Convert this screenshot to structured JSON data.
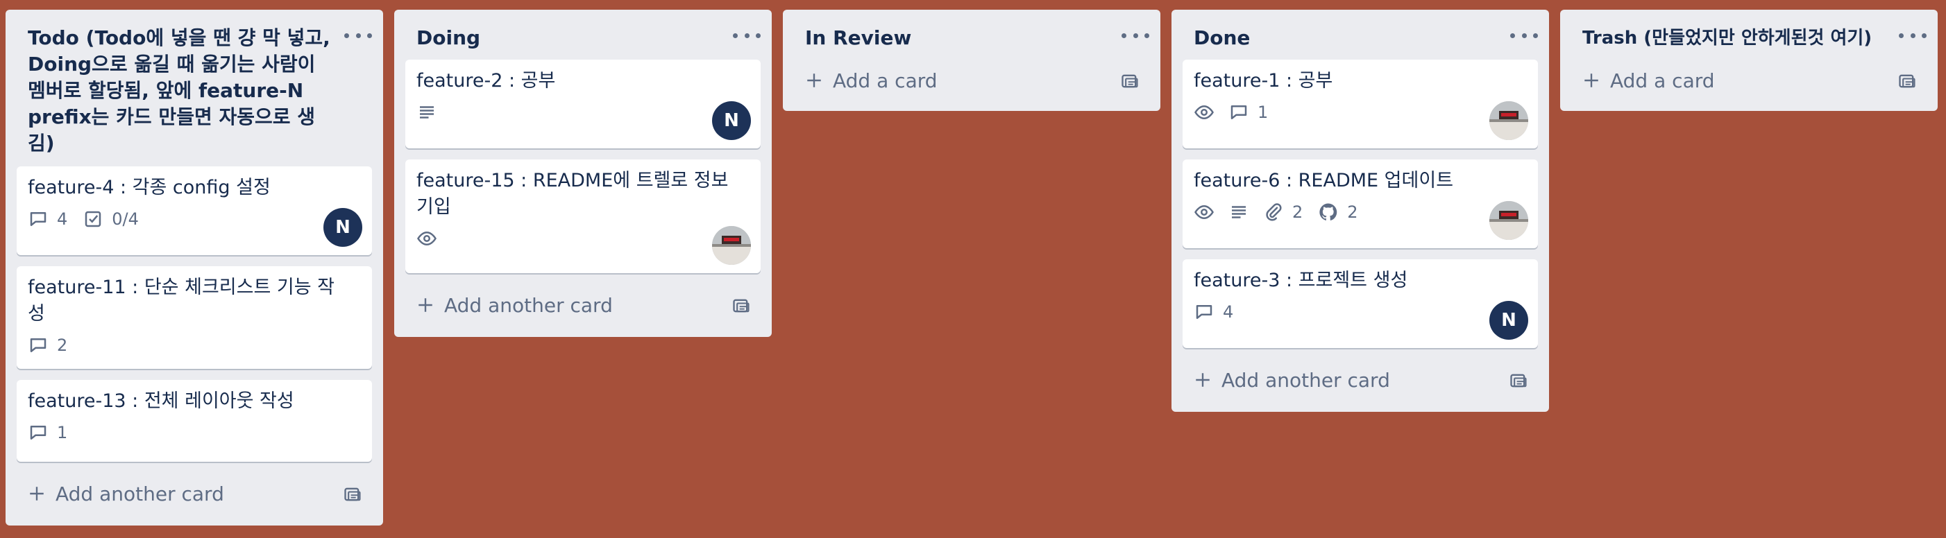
{
  "colors": {
    "board_bg": "#a6503a",
    "list_bg": "#ebecf0",
    "avatar_n": "#1d3258"
  },
  "lists": [
    {
      "title": "Todo (Todo에 넣을 땐 걍 막 넣고, Doing으로 옮길 때 옮기는 사람이 멤버로 할당됨, 앞에 feature-N prefix는 카드 만들면 자동으로 생김)",
      "add_label": "Add another card",
      "cards": [
        {
          "title": "feature-4 : 각종 config 설정",
          "comments": "4",
          "checklist": "0/4",
          "avatar": "N"
        },
        {
          "title": "feature-11 : 단순 체크리스트 기능 작성",
          "comments": "2"
        },
        {
          "title": "feature-13 : 전체 레이아웃 작성",
          "comments": "1"
        }
      ]
    },
    {
      "title": "Doing",
      "add_label": "Add another card",
      "cards": [
        {
          "title": "feature-2 : 공부",
          "avatar": "N",
          "icons": [
            "description-icon"
          ]
        },
        {
          "title": "feature-15 : README에 트렐로 정보 기입",
          "icons": [
            "watch-icon"
          ],
          "avatar": "photo"
        }
      ]
    },
    {
      "title": "In Review",
      "add_label": "Add a card",
      "cards": []
    },
    {
      "title": "Done",
      "add_label": "Add another card",
      "cards": [
        {
          "title": "feature-1 : 공부",
          "comments": "1",
          "icons": [
            "watch-icon"
          ],
          "avatar": "photo"
        },
        {
          "title": "feature-6 : README 업데이트",
          "attachments": "2",
          "github": "2",
          "icons": [
            "watch-icon",
            "description-icon"
          ],
          "avatar": "photo"
        },
        {
          "title": "feature-3 : 프로젝트 생성",
          "comments": "4",
          "avatar": "N"
        }
      ]
    },
    {
      "title": "Trash (만들었지만 안하게된것 여기)",
      "add_label": "Add a card",
      "cards": []
    }
  ]
}
